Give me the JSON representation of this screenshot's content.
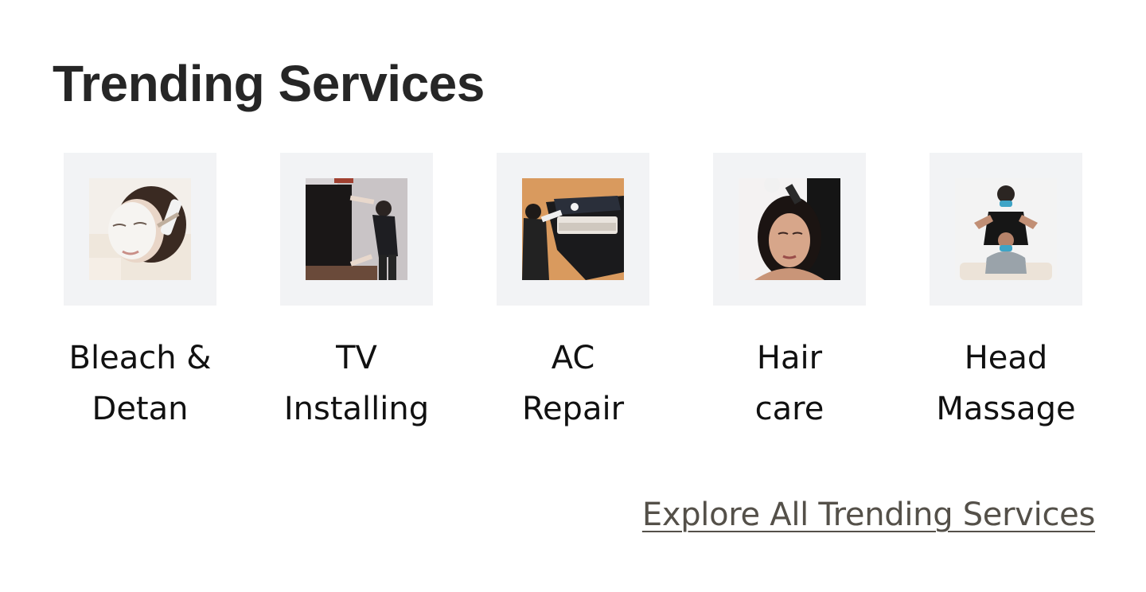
{
  "section": {
    "title": "Trending Services"
  },
  "services": [
    {
      "label_line1": "Bleach &",
      "label_line2": "Detan",
      "icon": "facial-photo"
    },
    {
      "label_line1": "TV",
      "label_line2": "Installing",
      "icon": "tv-install-photo"
    },
    {
      "label_line1": "AC",
      "label_line2": "Repair",
      "icon": "ac-repair-photo"
    },
    {
      "label_line1": "Hair",
      "label_line2": "care",
      "icon": "hair-care-photo"
    },
    {
      "label_line1": "Head",
      "label_line2": "Massage",
      "icon": "head-massage-photo"
    }
  ],
  "explore": {
    "label": "Explore All Trending Services"
  },
  "colors": {
    "title": "#262626",
    "tile_bg": "#f2f3f5",
    "label": "#111111",
    "link": "#545049"
  }
}
